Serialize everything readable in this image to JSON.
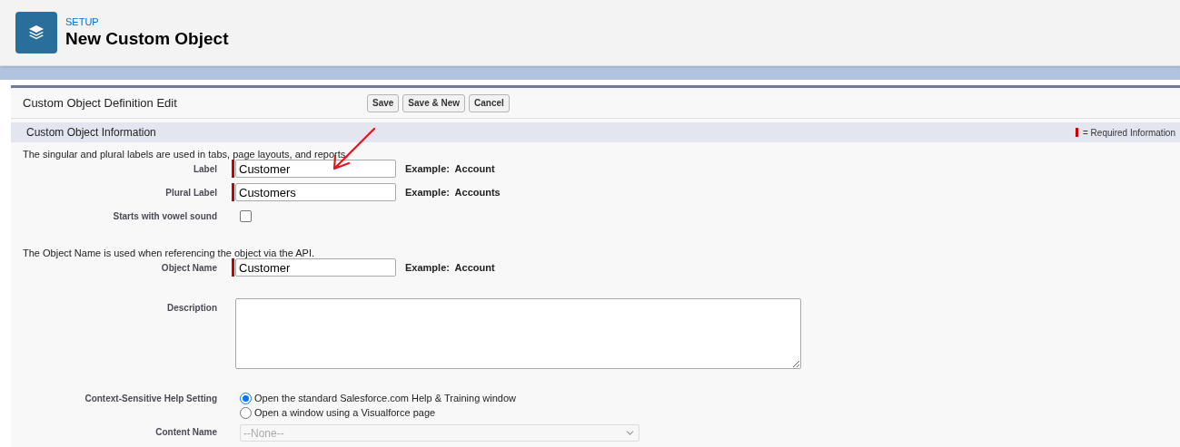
{
  "header": {
    "breadcrumb": "SETUP",
    "title": "New Custom Object"
  },
  "form": {
    "title": "Custom Object Definition Edit",
    "buttons": [
      "Save",
      "Save & New",
      "Cancel"
    ],
    "section": {
      "title": "Custom Object Information",
      "required_legend": "= Required Information"
    },
    "blocks": [
      {
        "intro": "The singular and plural labels are used in tabs, page layouts, and reports.",
        "fields": [
          {
            "kind": "text",
            "label": "Label",
            "value": "Customer",
            "required": true,
            "example": "Example:  Account"
          },
          {
            "kind": "text",
            "label": "Plural Label",
            "value": "Customers",
            "required": true,
            "example": "Example:  Accounts"
          },
          {
            "kind": "checkbox",
            "label": "Starts with vowel sound",
            "checked": false
          }
        ]
      },
      {
        "intro": "The Object Name is used when referencing the object via the API.",
        "fields": [
          {
            "kind": "text",
            "label": "Object Name",
            "value": "Customer",
            "required": true,
            "example": "Example:  Account"
          },
          {
            "kind": "textarea",
            "label": "Description",
            "required": false
          },
          {
            "kind": "radio",
            "label": "Context-Sensitive Help Setting",
            "options": [
              {
                "label": "Open the standard Salesforce.com Help & Training window",
                "selected": true
              },
              {
                "label": "Open a window using a Visualforce page",
                "selected": false
              }
            ]
          },
          {
            "kind": "select",
            "label": "Content Name",
            "value": "--None--",
            "disabled": true
          }
        ]
      }
    ]
  }
}
